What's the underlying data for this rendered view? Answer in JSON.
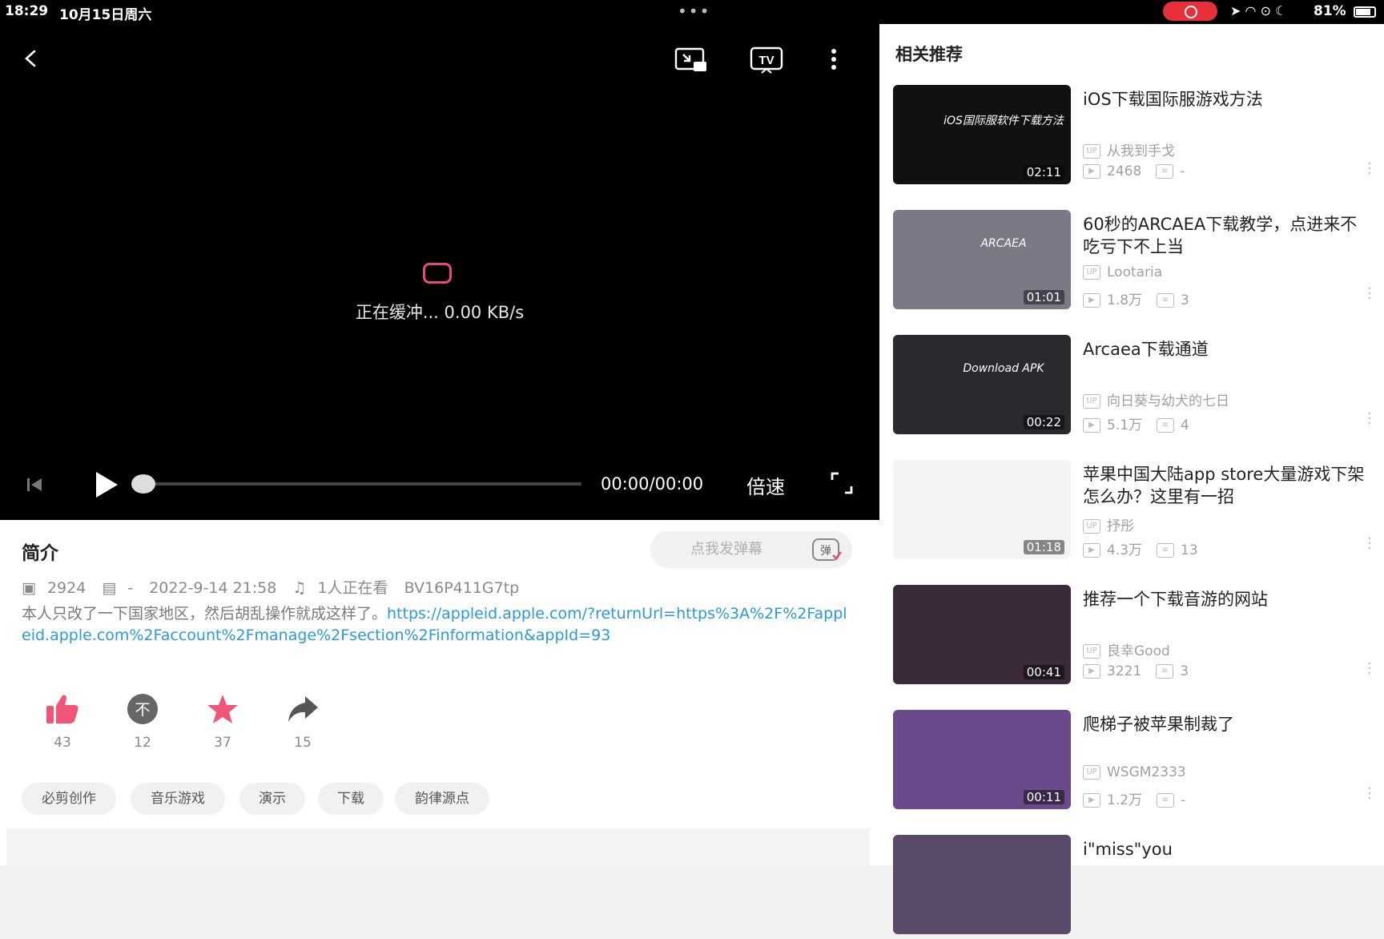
{
  "status": {
    "time": "18:29",
    "date": "10月15日周六",
    "battery_pct": "81%",
    "battery_level": 0.81
  },
  "player": {
    "buffer_text": "正在缓冲... 0.00 KB/s",
    "time": "00:00/00:00",
    "speed_label": "倍速",
    "progress": 0
  },
  "intro": {
    "title": "简介",
    "danmaku_placeholder": "点我发弹幕",
    "danmaku_btn": "弹",
    "views": "2924",
    "danmaku_count": "-",
    "datetime": "2022-9-14  21:58",
    "watching": "1人正在看",
    "bvid": "BV16P411G7tp",
    "desc_text": "本人只改了一下国家地区，然后胡乱操作就成这样了。",
    "desc_link": "https://appleid.apple.com/?returnUrl=https%3A%2F%2Fappleid.apple.com%2Faccount%2Fmanage%2Fsection%2Finformation&appId=93",
    "like": "43",
    "dislike": "12",
    "fav": "37",
    "share": "15",
    "dislike_glyph": "不",
    "tags": [
      "必剪创作",
      "音乐游戏",
      "演示",
      "下载",
      "韵律源点"
    ]
  },
  "recommend": {
    "title": "相关推荐",
    "up_badge": "UP",
    "items": [
      {
        "title": "iOS下载国际服游戏方法",
        "up": "从我到手戈",
        "views": "2468",
        "danmaku": "-",
        "duration": "02:11",
        "thumb_text": "iOS国际服软件下载方法",
        "color": "#111111"
      },
      {
        "title": "60秒的ARCAEA下载教学，点进来不吃亏下不上当",
        "up": "Lootaria",
        "views": "1.8万",
        "danmaku": "3",
        "duration": "01:01",
        "thumb_text": "ARCAEA",
        "color": "#7a7a86"
      },
      {
        "title": "Arcaea下载通道",
        "up": "向日葵与幼犬的七日",
        "views": "5.1万",
        "danmaku": "4",
        "duration": "00:22",
        "thumb_text": "Download APK",
        "color": "#2a2a2e"
      },
      {
        "title": "苹果中国大陆app store大量游戏下架怎么办？这里有一招",
        "up": "抒彤",
        "views": "4.3万",
        "danmaku": "13",
        "duration": "01:18",
        "thumb_text": "",
        "color": "#f4f4f4"
      },
      {
        "title": "推荐一个下载音游的网站",
        "up": "良幸Good",
        "views": "3221",
        "danmaku": "3",
        "duration": "00:41",
        "thumb_text": "",
        "color": "#3a2a3a"
      },
      {
        "title": "爬梯子被苹果制裁了",
        "up": "WSGM2333",
        "views": "1.2万",
        "danmaku": "-",
        "duration": "00:11",
        "thumb_text": "",
        "color": "#6a4a8a"
      },
      {
        "title": "i\"miss\"you",
        "up": "",
        "views": "",
        "danmaku": "",
        "duration": "",
        "thumb_text": "",
        "color": "#5a4a6a"
      }
    ]
  }
}
